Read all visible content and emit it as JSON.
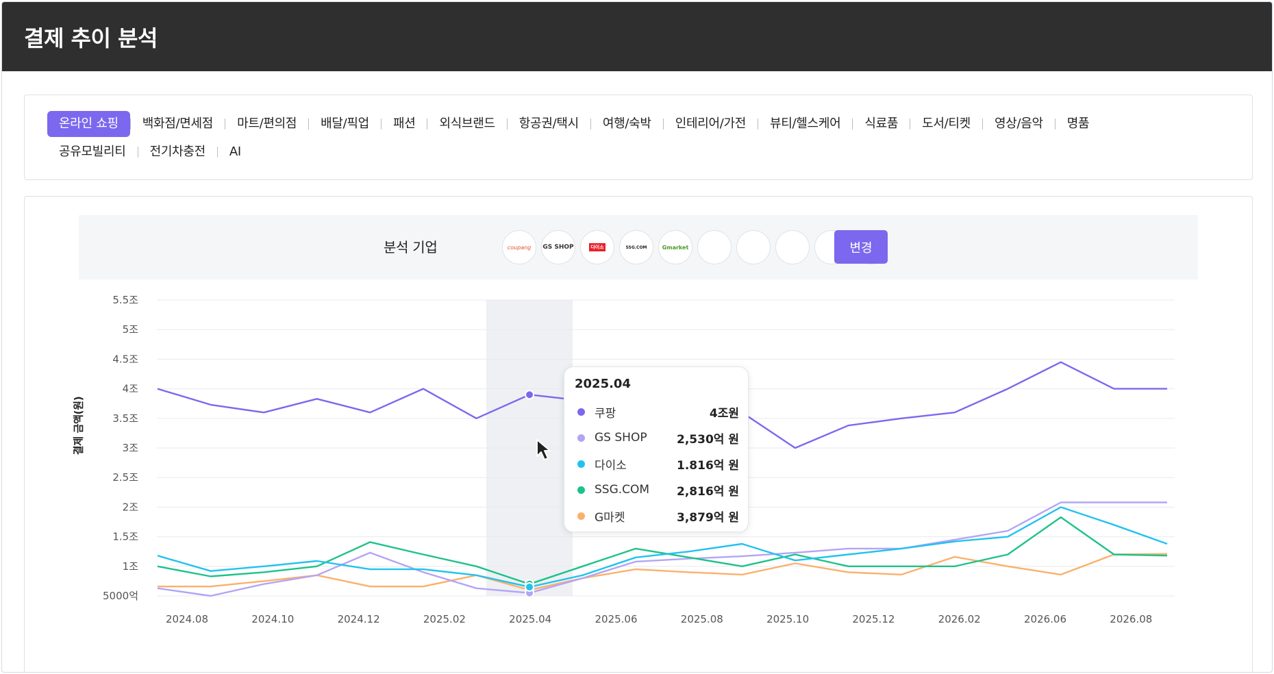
{
  "header": {
    "title": "결제 추이 분석"
  },
  "categories": {
    "row1": [
      "온라인 쇼핑",
      "백화점/면세점",
      "마트/편의점",
      "배달/픽업",
      "패션",
      "외식브랜드",
      "항공권/택시",
      "여행/숙박",
      "인테리어/가전",
      "뷰티/헬스케어",
      "식료품",
      "도서/티켓",
      "영상/음악",
      "명품"
    ],
    "row2": [
      "공유모빌리티",
      "전기차충전",
      "AI"
    ],
    "active": "온라인 쇼핑"
  },
  "selector": {
    "label": "분석 기업",
    "logos": [
      {
        "name": "coupang",
        "text": "coupang",
        "icon": "coupang-logo"
      },
      {
        "name": "gsshop",
        "text": "GS SHOP",
        "icon": "gsshop-logo"
      },
      {
        "name": "daiso",
        "text": "다이소",
        "icon": "daiso-logo"
      },
      {
        "name": "ssg",
        "text": "SSG.COM",
        "icon": "ssg-logo"
      },
      {
        "name": "gmarket",
        "text": "Gmarket",
        "icon": "gmarket-logo"
      }
    ],
    "empty_slots": 5,
    "change_button": "변경"
  },
  "colors": {
    "accent": "#7b68ee",
    "coupang": "#7b68ee",
    "gsshop": "#b3a4f5",
    "daiso": "#22c2ef",
    "ssg": "#1dc289",
    "gmarket": "#fbb06c"
  },
  "chart_data": {
    "type": "line",
    "ylabel": "결제 금액(원)",
    "xlabel": "",
    "y_ticks": [
      {
        "value": 5000,
        "label": "5000억"
      },
      {
        "value": 10000,
        "label": "1조"
      },
      {
        "value": 15000,
        "label": "1.5조"
      },
      {
        "value": 20000,
        "label": "2조"
      },
      {
        "value": 25000,
        "label": "2.5조"
      },
      {
        "value": 30000,
        "label": "3조"
      },
      {
        "value": 35000,
        "label": "3.5조"
      },
      {
        "value": 40000,
        "label": "4조"
      },
      {
        "value": 45000,
        "label": "4.5조"
      },
      {
        "value": 50000,
        "label": "5조"
      },
      {
        "value": 55000,
        "label": "5.5조"
      }
    ],
    "x_tick_labels": [
      "2024.08",
      "2024.10",
      "2024.12",
      "2025.02",
      "2025.04",
      "2025.06",
      "2025.08",
      "2025.10",
      "2025.12",
      "2026.02",
      "2026.06",
      "2026.08"
    ],
    "x_point_count": 20,
    "highlight_index": 7,
    "highlight_label": "2025.04",
    "ylim": [
      5000,
      55000
    ],
    "grid": true,
    "series": [
      {
        "name": "쿠팡",
        "key": "coupang",
        "values": [
          40000,
          37300,
          36000,
          38300,
          36000,
          40000,
          35000,
          39000,
          38000,
          35500,
          41500,
          36000,
          30000,
          33800,
          35000,
          36000,
          40000,
          44500,
          40000,
          40000
        ]
      },
      {
        "name": "GS SHOP",
        "key": "gsshop",
        "values": [
          6300,
          5000,
          7000,
          8500,
          12300,
          9000,
          6300,
          5500,
          8000,
          10800,
          11300,
          11700,
          12300,
          13000,
          13000,
          14500,
          16000,
          20800,
          20800,
          20800
        ]
      },
      {
        "name": "다이소",
        "key": "daiso",
        "values": [
          11800,
          9200,
          10000,
          10900,
          9500,
          9500,
          8500,
          6500,
          8500,
          11500,
          12500,
          13800,
          11000,
          12000,
          13000,
          14200,
          15000,
          20000,
          17000,
          13800
        ]
      },
      {
        "name": "SSG.COM",
        "key": "ssg",
        "values": [
          10000,
          8300,
          9000,
          10000,
          14100,
          12000,
          10000,
          7000,
          10000,
          13000,
          11500,
          10000,
          12000,
          10000,
          10000,
          10000,
          12000,
          18300,
          12000,
          11800
        ]
      },
      {
        "name": "G마켓",
        "key": "gmarket",
        "values": [
          6600,
          6600,
          7500,
          8500,
          6600,
          6600,
          8500,
          6000,
          8000,
          9500,
          9000,
          8600,
          10500,
          9000,
          8600,
          11600,
          10000,
          8600,
          12000,
          12100
        ]
      }
    ]
  },
  "tooltip": {
    "title": "2025.04",
    "rows": [
      {
        "name": "쿠팡",
        "value": "4조원",
        "key": "coupang"
      },
      {
        "name": "GS SHOP",
        "value": "2,530억 원",
        "key": "gsshop"
      },
      {
        "name": "다이소",
        "value": "1.816억 원",
        "key": "daiso"
      },
      {
        "name": "SSG.COM",
        "value": "2,816억 원",
        "key": "ssg"
      },
      {
        "name": "G마켓",
        "value": "3,879억 원",
        "key": "gmarket"
      }
    ]
  }
}
